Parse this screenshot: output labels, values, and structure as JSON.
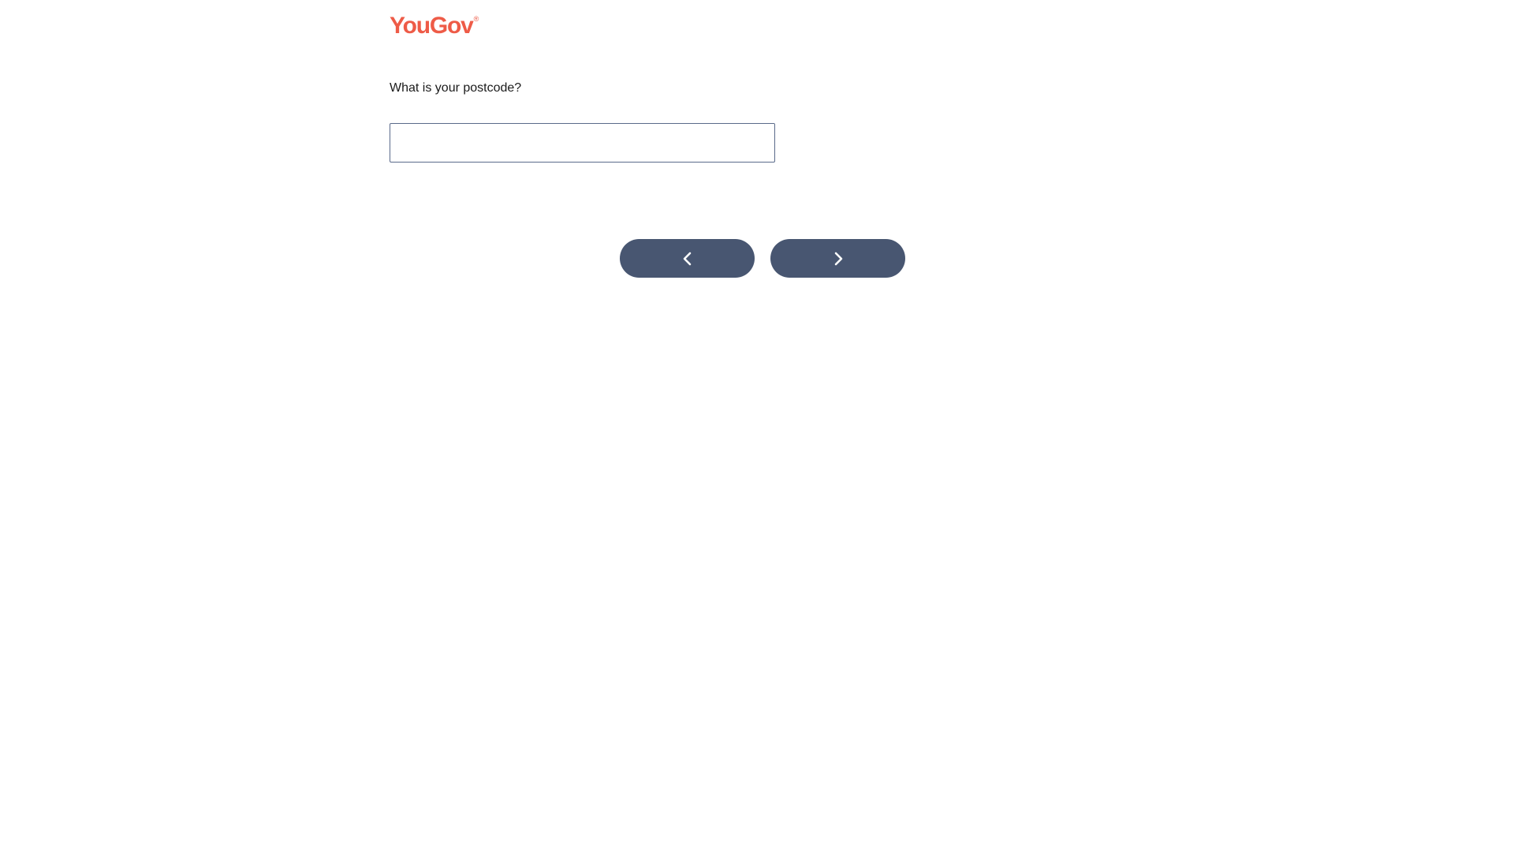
{
  "brand": {
    "name": "YouGov",
    "registered_mark": "®",
    "color": "#ee5b47"
  },
  "question": {
    "text": "What is your postcode?"
  },
  "answer": {
    "value": "",
    "placeholder": ""
  },
  "navigation": {
    "back_icon": "chevron-left-icon",
    "next_icon": "chevron-right-icon",
    "button_color": "#485671"
  }
}
